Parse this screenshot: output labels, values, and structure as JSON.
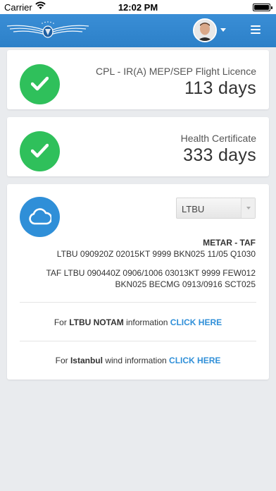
{
  "status_bar": {
    "carrier": "Carrier",
    "time": "12:02 PM"
  },
  "navbar": {
    "brand_color": "#3a8ed6"
  },
  "licence_card": {
    "label": "CPL - IR(A) MEP/SEP Flight Licence",
    "days": "113 days",
    "status_color": "#2fc05b",
    "icon": "check-icon"
  },
  "health_card": {
    "label": "Health Certificate",
    "days": "333 days",
    "status_color": "#2fc05b",
    "icon": "check-icon"
  },
  "weather_card": {
    "icon": "cloud-icon",
    "airport_select": {
      "value": "LTBU"
    },
    "metar_title": "METAR - TAF",
    "metar": "LTBU 090920Z 02015KT 9999 BKN025 11/05 Q1030",
    "taf": "TAF LTBU 090440Z 0906/1006 03013KT 9999 FEW012 BKN025 BECMG 0913/0916 SCT025",
    "notam": {
      "prefix": "For",
      "subject": "LTBU NOTAM",
      "middle": "information",
      "link": "CLICK HERE"
    },
    "wind": {
      "prefix": "For",
      "subject": "Istanbul",
      "middle": "wind information",
      "link": "CLICK HERE"
    },
    "link_color": "#2f8fd8"
  }
}
